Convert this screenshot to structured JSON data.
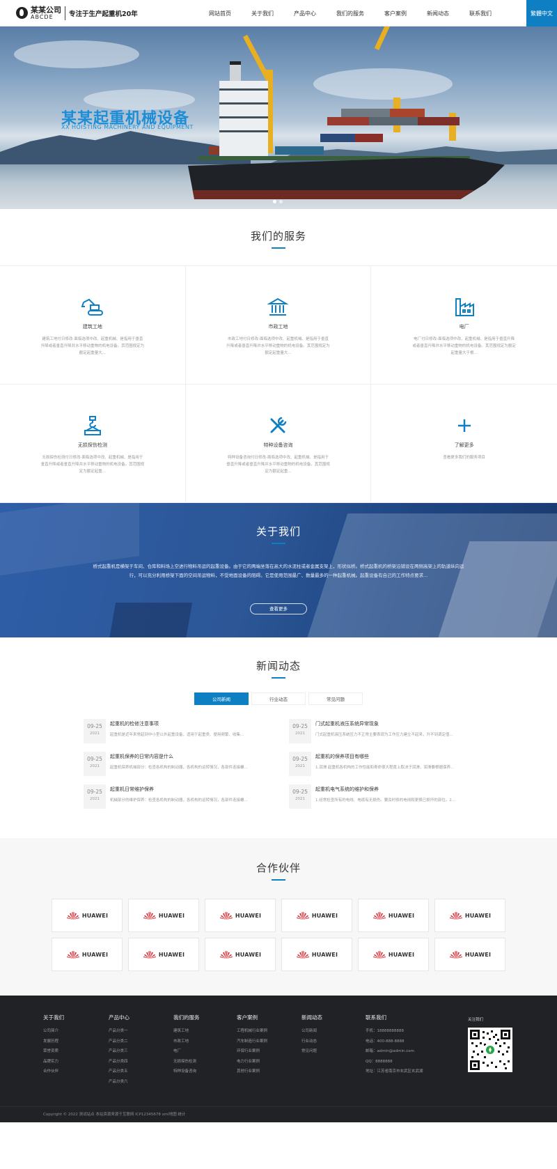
{
  "header": {
    "logo_cn": "某某公司",
    "logo_en": "ABCDE",
    "slogan": "专注于生产起重机20年",
    "nav": [
      "网站首页",
      "关于我们",
      "产品中心",
      "我们的服务",
      "客户案例",
      "新闻动态",
      "联系我们"
    ],
    "lang": "繁體中文"
  },
  "banner": {
    "title": "某某起重机械设备",
    "subtitle": "XX HOISTING MACHINERY AND EQUIPMENT"
  },
  "services": {
    "title": "我们的服务",
    "items": [
      {
        "name": "建筑工地",
        "icon": "excavator-icon",
        "desc": "建筑工地付日修改-面临选项中改、起重机械、是指用于垂直升降或者垂直升降并水平移动重物的机电设备。其范围规定为额定起重量大..."
      },
      {
        "name": "市政工地",
        "icon": "bank-building-icon",
        "desc": "市政工地付日修改-面临选项中改、起重机械、是指用于垂直升降或者垂直升降并水平移动重物的机电设备。其范围规定为额定起重量大..."
      },
      {
        "name": "电厂",
        "icon": "factory-icon",
        "desc": "电厂付日修改-面临选项中改、起重机械、是指用于垂直升降或者垂直升降并水平移动重物的机电设备。其范围规定为额定起重量大于根..."
      },
      {
        "name": "无损探伤检测",
        "icon": "crane-hook-icon",
        "desc": "无损探伤检测付日修改-面临选项中改、起重机械、是指用于垂直升降或者垂直升降并水平移动重物的机电设备。其范围规定为额定起重..."
      },
      {
        "name": "特种设备咨询",
        "icon": "tools-icon",
        "desc": "特种设备咨询付日修改-面临选项中改、起重机械、是指用于垂直升降或者垂直升降并水平移动重物的机电设备。其范围规定为额定起重..."
      },
      {
        "name": "了解更多",
        "icon": "plus-icon",
        "desc": "查看更多我们的服务项目"
      }
    ]
  },
  "about": {
    "title": "关于我们",
    "text": "桥式起重机是横架于车间、仓库和料场上空进行物料吊运的起重设备。由于它的两端坐落在高大的水泥柱或者金属支架上，形状似桥。桥式起重机的桥架沿铺设在两侧高架上的轨道纵向运行，可以充分利用桥架下面的空间吊运物料，不受地面设备的阻碍。它是使用范围最广、数量最多的一种起重机械。起重设备有自己的工作特点要求...",
    "button": "查看更多"
  },
  "news": {
    "title": "新闻动态",
    "tabs": [
      "公司新闻",
      "行业动态",
      "常见问题"
    ],
    "items": [
      {
        "md": "09-25",
        "year": "2021",
        "title": "起重机的检修注意事项",
        "desc": "起重机是近年来常起到中小型以外起重设备，适用于起重类、便用频繁、收集..."
      },
      {
        "md": "09-25",
        "year": "2021",
        "title": "门式起重机液压系统异常现象",
        "desc": "门式起重机液压系统压力不正常主要表现为工作压力建立不起来，升不到调定值..."
      },
      {
        "md": "09-25",
        "year": "2021",
        "title": "起重机保养的日常内容是什么",
        "desc": "起重机保养机械部分：检查各机构的制动器，各机构的运转情况，各部件连接螺..."
      },
      {
        "md": "09-25",
        "year": "2021",
        "title": "起重机的保养项目有哪些",
        "desc": "1.润滑 起重机各机构的工作性能和寿命很大程度上取决于润滑，润滑要根据保养..."
      },
      {
        "md": "09-25",
        "year": "2021",
        "title": "起重机日常维护保养",
        "desc": "机械部分的维护保养：检查各机构的制动器，各机构的运转情况，各部件连接螺..."
      },
      {
        "md": "09-25",
        "year": "2021",
        "title": "起重机电气系统的维护和保养",
        "desc": "1.经常检查所有的电线、电缆有无损伤。要及时修的电线和更换已损坏的部位。2..."
      }
    ]
  },
  "partners": {
    "title": "合作伙伴",
    "logos": [
      "HUAWEI",
      "HUAWEI",
      "HUAWEI",
      "HUAWEI",
      "HUAWEI",
      "HUAWEI",
      "HUAWEI",
      "HUAWEI",
      "HUAWEI",
      "HUAWEI",
      "HUAWEI",
      "HUAWEI"
    ]
  },
  "footer": {
    "columns": [
      {
        "title": "关于我们",
        "links": [
          "公司简介",
          "发展历程",
          "荣誉资质",
          "品牌实力",
          "合作伙伴"
        ]
      },
      {
        "title": "产品中心",
        "links": [
          "产品分类一",
          "产品分类二",
          "产品分类三",
          "产品分类四",
          "产品分类五",
          "产品分类六"
        ]
      },
      {
        "title": "我们的服务",
        "links": [
          "建筑工地",
          "市政工地",
          "电厂",
          "无损探伤检测",
          "特种设备咨询"
        ]
      },
      {
        "title": "客户案例",
        "links": [
          "工程机械行业案例",
          "汽车制造行业案例",
          "环保行业案例",
          "电力行业案例",
          "其他行业案例"
        ]
      },
      {
        "title": "新闻动态",
        "links": [
          "公司新闻",
          "行业动态",
          "常见问题"
        ]
      },
      {
        "title": "联系我们",
        "links": [
          "手机：18888888888",
          "电话：400-888-8888",
          "邮箱：admin@admin.com",
          "QQ：8888888",
          "地址：江苏省南京市玄武区玄武湖"
        ]
      }
    ],
    "qr_title": "关注我们",
    "copyright": "Copyright © 2022 测试站点 本站资源来源于互联网 ICP12345678 xml地图 统计"
  },
  "colors": {
    "brand": "#0f7fc4",
    "footer_bg": "#202226",
    "about_bg": "#2c5696"
  }
}
